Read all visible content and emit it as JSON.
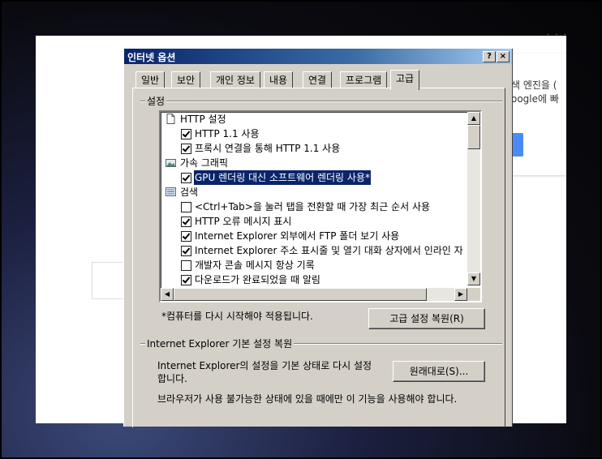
{
  "background": {
    "search_text_1": "색 엔진을 (",
    "search_text_2": "oogle에 빠"
  },
  "dialog": {
    "title": "인터넷 옵션",
    "help_label": "?",
    "close_label": "×",
    "tabs": [
      {
        "label": "일반"
      },
      {
        "label": "보안"
      },
      {
        "label": "개인 정보"
      },
      {
        "label": "내용"
      },
      {
        "label": "연결"
      },
      {
        "label": "프로그램"
      },
      {
        "label": "고급"
      }
    ],
    "settings_group_label": "설정",
    "settings": [
      {
        "kind": "category",
        "icon": "page-icon",
        "label": "HTTP 설정"
      },
      {
        "kind": "checkbox",
        "checked": true,
        "label": "HTTP 1.1 사용"
      },
      {
        "kind": "checkbox",
        "checked": true,
        "label": "프록시 연결을 통해 HTTP 1.1 사용"
      },
      {
        "kind": "category",
        "icon": "image-icon",
        "label": "가속 그래픽"
      },
      {
        "kind": "checkbox",
        "checked": true,
        "selected": true,
        "label": "GPU 렌더링 대신 소프트웨어 렌더링 사용*"
      },
      {
        "kind": "category",
        "icon": "list-icon",
        "label": "검색"
      },
      {
        "kind": "checkbox",
        "checked": false,
        "label": "<Ctrl+Tab>을 눌러 탭을 전환할 때 가장 최근 순서 사용"
      },
      {
        "kind": "checkbox",
        "checked": true,
        "label": "HTTP 오류 메시지 표시"
      },
      {
        "kind": "checkbox",
        "checked": true,
        "label": "Internet Explorer 외부에서 FTP 폴더 보기 사용"
      },
      {
        "kind": "checkbox",
        "checked": true,
        "label": "Internet Explorer 주소 표시줄 및 열기 대화 상자에서 인라인 자"
      },
      {
        "kind": "checkbox",
        "checked": false,
        "label": "개발자 콘솔 메시지 항상 기록"
      },
      {
        "kind": "checkbox",
        "checked": true,
        "label": "다운로드가 완료되었을 때 알림"
      }
    ],
    "restart_note": "*컴퓨터를 다시 시작해야 적용됩니다.",
    "restore_advanced_button": "고급 설정 복원(R)",
    "reset_group_label": "Internet Explorer 기본 설정 복원",
    "reset_description_line1": "Internet Explorer의 설정을 기본 상태로 다시 설정",
    "reset_description_line2": "합니다.",
    "reset_button": "원래대로(S)...",
    "reset_warning": "브라우저가 사용 불가능한 상태에 있을 때에만 이 기능을 사용해야 합니다."
  }
}
